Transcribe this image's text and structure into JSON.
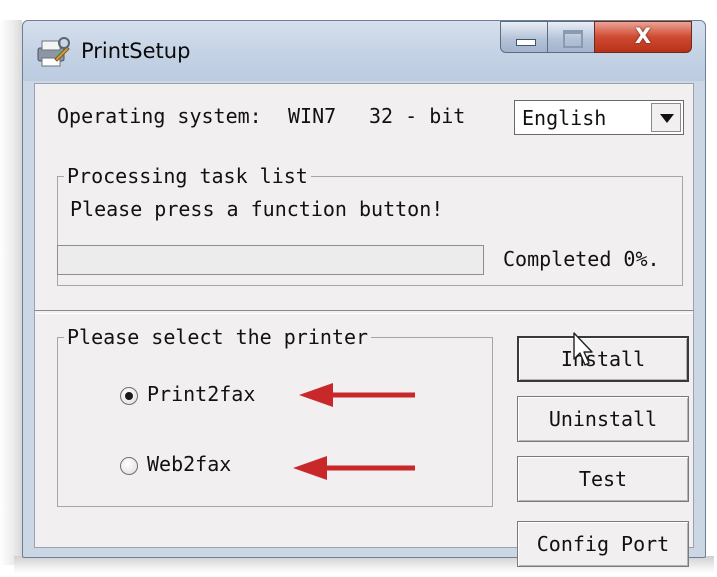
{
  "window": {
    "title": "PrintSetup",
    "icon": "printer-setup-icon",
    "controls": {
      "minimize_icon": "minimize-icon",
      "maximize_icon": "maximize-icon",
      "close_glyph": "X"
    }
  },
  "system_info": {
    "os_label": "Operating system:",
    "os_value": "WIN7",
    "bits": "32 - bit"
  },
  "language": {
    "selected": "English"
  },
  "task_group": {
    "legend": "Processing task list",
    "message": "Please press a function button!",
    "progress_value": 0,
    "progress_text": "Completed 0%."
  },
  "printer_group": {
    "legend": "Please select the printer",
    "options": [
      {
        "label": "Print2fax",
        "selected": true
      },
      {
        "label": "Web2fax",
        "selected": false
      }
    ]
  },
  "buttons": {
    "install": "Install",
    "uninstall": "Uninstall",
    "test": "Test",
    "config_port": "Config Port"
  },
  "colors": {
    "annotation_arrow": "#c8282a",
    "titlebar": "#c4d2e4",
    "close_button": "#cf4a32",
    "client_background": "#f1eff0"
  }
}
